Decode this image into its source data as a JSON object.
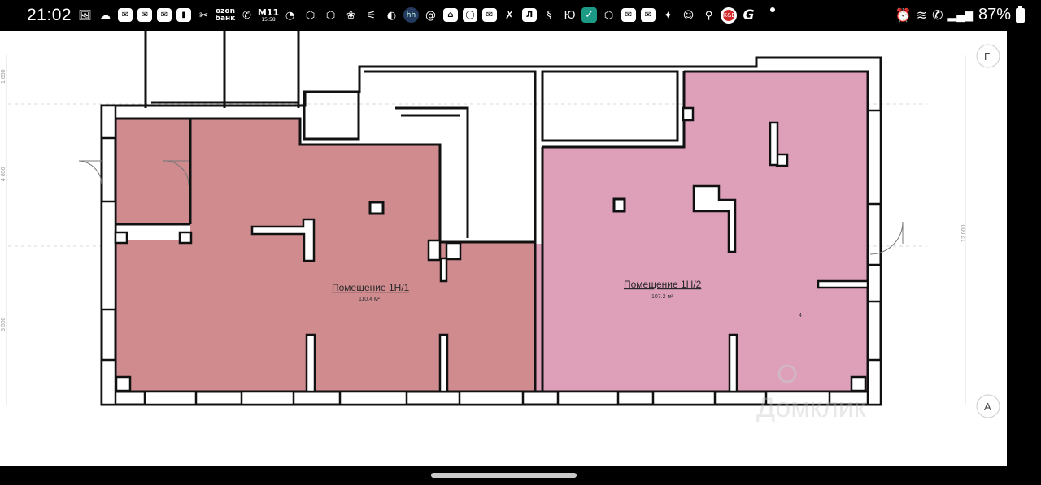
{
  "status_bar": {
    "time": "21:02",
    "battery_percent": "87%",
    "notification_icons": [
      "gallery-icon",
      "cloud-icon",
      "mail-icon",
      "mail-icon",
      "mail-icon",
      "app-icon",
      "bank-icon",
      "ozon-bank-icon",
      "viber-icon",
      "m11-icon",
      "check-icon",
      "vpn-icon",
      "vpn-icon",
      "paw-icon",
      "satellite-icon",
      "browser-icon",
      "app-icon",
      "at-icon",
      "home-icon",
      "oval-icon",
      "mail-icon",
      "delivery-icon",
      "lukoil-icon",
      "app-icon",
      "yu-icon",
      "check-icon",
      "vpn-icon",
      "mail-icon",
      "mail-icon",
      "star-icon",
      "ok-icon",
      "location-icon",
      "kb-icon",
      "g-icon"
    ],
    "ozon_text": [
      "ozon",
      "банк"
    ],
    "m11_text": [
      "M11",
      "15:58"
    ],
    "kb_text": "К&Б",
    "system_icons": [
      "alarm-icon",
      "wifi-icon",
      "wifi-call-icon",
      "signal-icon",
      "battery-icon"
    ]
  },
  "floor_plan": {
    "rooms": [
      {
        "name": "Помещение 1Н/1",
        "area": "110.4 м²",
        "color": "#d08b8f"
      },
      {
        "name": "Помещение 1Н/2",
        "area": "107.2 м²",
        "color": "#de9fb9"
      }
    ],
    "axis_labels": {
      "top": "Г",
      "bottom": "А"
    },
    "dimensions": {
      "left_top": "1 650",
      "left_mid": "4 850",
      "left_bottom": "5 500",
      "right": "12 000"
    },
    "small_mark": "4",
    "watermark": "Домклик"
  },
  "colors": {
    "room_1": "#d08b8f",
    "room_2": "#de9fb9",
    "wall": "#111111",
    "background": "#ffffff"
  }
}
